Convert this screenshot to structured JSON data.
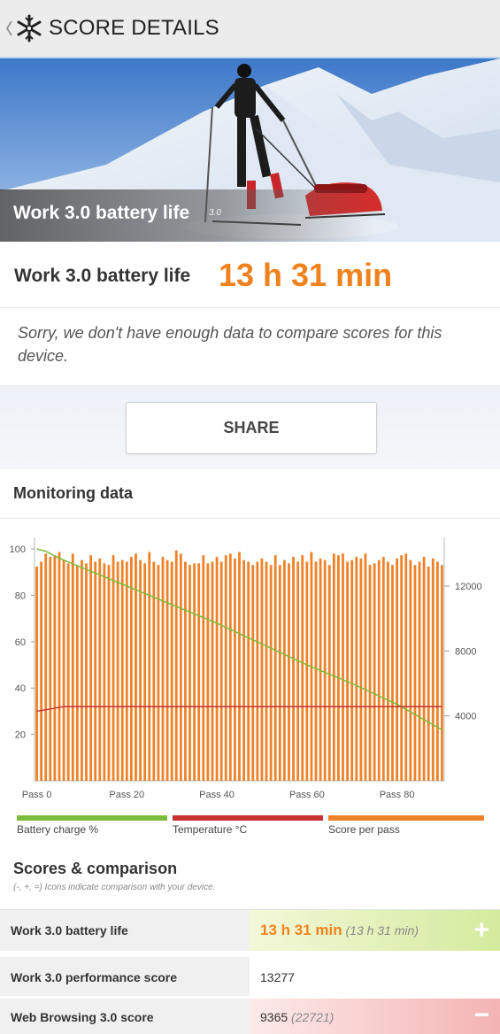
{
  "header": {
    "title": "SCORE DETAILS"
  },
  "hero": {
    "title": "Work 3.0 battery life",
    "version": "3.0"
  },
  "result": {
    "label": "Work 3.0 battery life",
    "value": "13 h 31 min",
    "note": "Sorry, we don't have enough data to compare scores for this device."
  },
  "share": {
    "label": "SHARE"
  },
  "monitoring": {
    "title": "Monitoring data"
  },
  "chart_data": {
    "type": "bar",
    "x_ticks": [
      "Pass 0",
      "Pass 20",
      "Pass 40",
      "Pass 60",
      "Pass 80"
    ],
    "left_ticks": [
      "100",
      "80",
      "60",
      "40",
      "20"
    ],
    "right_ticks": [
      "12000",
      "8000",
      "4000"
    ],
    "left_range": [
      0,
      105
    ],
    "right_range": [
      0,
      15000
    ],
    "passes": 91,
    "series": [
      {
        "name": "Battery charge %",
        "type": "line",
        "axis": "left",
        "points": [
          [
            0,
            100
          ],
          [
            2,
            99
          ],
          [
            5,
            96
          ],
          [
            10,
            92
          ],
          [
            20,
            84
          ],
          [
            30,
            76
          ],
          [
            40,
            68
          ],
          [
            50,
            59
          ],
          [
            60,
            50
          ],
          [
            70,
            42
          ],
          [
            80,
            33
          ],
          [
            90,
            22
          ]
        ]
      },
      {
        "name": "Temperature °C",
        "type": "line",
        "axis": "left",
        "points": [
          [
            0,
            30
          ],
          [
            3,
            31
          ],
          [
            6,
            32
          ],
          [
            90,
            32
          ]
        ]
      },
      {
        "name": "Score per pass",
        "type": "bar",
        "axis": "right",
        "values": [
          13200,
          13500,
          14000,
          13800,
          13900,
          14100,
          13600,
          13400,
          14000,
          13300,
          13600,
          13400,
          13900,
          13500,
          13700,
          13400,
          13300,
          13900,
          13500,
          13600,
          13500,
          13800,
          14000,
          13600,
          13400,
          14100,
          13500,
          13300,
          13800,
          13600,
          13500,
          14200,
          14000,
          13500,
          13300,
          13400,
          13400,
          13900,
          13400,
          13500,
          13800,
          13500,
          13900,
          14000,
          13700,
          14100,
          13600,
          13500,
          13300,
          13500,
          13700,
          13500,
          13300,
          13900,
          13300,
          13600,
          13400,
          13800,
          13500,
          13900,
          13500,
          14100,
          13500,
          13700,
          13600,
          13300,
          14000,
          13900,
          14000,
          13500,
          13600,
          13800,
          13700,
          14000,
          13300,
          13400,
          13600,
          13800,
          13500,
          13300,
          13700,
          13900,
          14000,
          13600,
          13300,
          13500,
          13800,
          13200,
          13700,
          13500,
          13300
        ]
      }
    ],
    "legend": [
      {
        "label": "Battery charge %",
        "color": "#7dbb3a"
      },
      {
        "label": "Temperature °C",
        "color": "#c83232"
      },
      {
        "label": "Score per pass",
        "color": "#ef8228"
      }
    ]
  },
  "scores": {
    "title": "Scores & comparison",
    "note": "(-, +, =) Icons indicate comparison with your device.",
    "rows": [
      {
        "name": "Work 3.0 battery life",
        "value": "13 h 31 min",
        "compare": "(13 h 31 min)",
        "icon": "plus-icon"
      },
      {
        "name": "Work 3.0 performance score",
        "value": "13277",
        "compare": ""
      },
      {
        "name": "Web Browsing 3.0 score",
        "value": "9365",
        "compare": "(22721)",
        "icon": "minus-icon"
      }
    ]
  },
  "colors": {
    "accent": "#f0821e",
    "battery": "#7dbb3a",
    "temperature": "#c83232",
    "score": "#ef8228"
  }
}
